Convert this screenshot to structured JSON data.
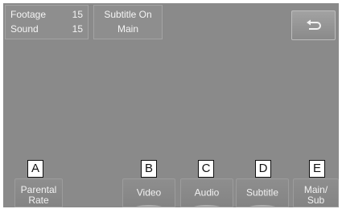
{
  "status": {
    "footage_label": "Footage",
    "footage_value": "15",
    "sound_label": "Sound",
    "sound_value": "15",
    "subtitle_line1": "Subtitle On",
    "subtitle_line2": "Main"
  },
  "back_button": {
    "icon": "back-arrow-icon"
  },
  "buttons": [
    {
      "label": "Parental\nRate",
      "callout": "A"
    },
    {
      "label": "Video",
      "callout": "B"
    },
    {
      "label": "Audio",
      "callout": "C"
    },
    {
      "label": "Subtitle",
      "callout": "D"
    },
    {
      "label": "Main/\nSub",
      "callout": "E"
    }
  ],
  "colors": {
    "screen_bg": "#8a8a8a",
    "text": "#f2f2f2",
    "callout_bg": "#ffffff",
    "callout_border": "#111111"
  }
}
